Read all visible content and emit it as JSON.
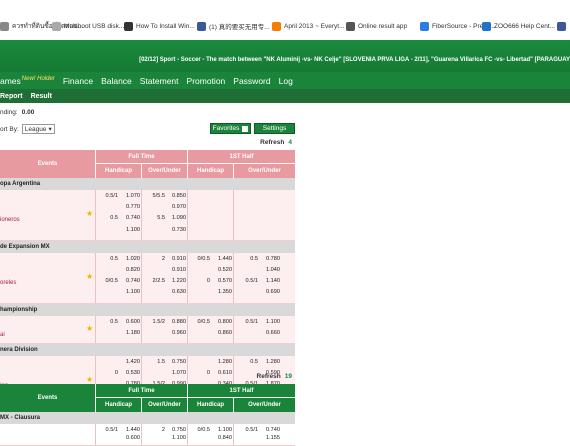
{
  "bookmarks": [
    {
      "label": "ควรทำที่ดินซื้อที่สุดตอน...",
      "icon": "bookmark-icon",
      "color": "#888888"
    },
    {
      "label": "Multiboot USB disk...",
      "icon": "doc-icon",
      "color": "#aaaaaa"
    },
    {
      "label": "How To Install Win...",
      "icon": "g-icon",
      "color": "#333333"
    },
    {
      "label": "(1) 真的要买无用专...",
      "icon": "facebook-icon",
      "color": "#3b5998"
    },
    {
      "label": "April 2013 ~ Everyt...",
      "icon": "blogger-icon",
      "color": "#f57d00"
    },
    {
      "label": "Online result app",
      "icon": "globe-icon",
      "color": "#555555"
    },
    {
      "label": "FiberSource - Precis...",
      "icon": "fiber-icon",
      "color": "#2a7de1"
    },
    {
      "label": "ZOO666 Help Cent...",
      "icon": "zoo-icon",
      "color": "#1e73c8"
    },
    {
      "label": "",
      "icon": "facebook-icon",
      "color": "#3b5998"
    }
  ],
  "ticker": "[02/12] Sport - Soccer - The match between \"NK Aluminij -vs- NK Celje\" [SLOVENIA PRVA LIGA - 2/11], \"Guarena Villarica FC -vs- Libertad\" [PARAGUAY",
  "nav": {
    "games": "ames",
    "new_badge": "New! Holder",
    "finance": "Finance",
    "balance": "Balance",
    "statement": "Statement",
    "promotion": "Promotion",
    "password": "Password",
    "log": "Log"
  },
  "subnav": {
    "report": "Report",
    "result": "Result"
  },
  "pending": {
    "label": "nding:",
    "value": "0.00"
  },
  "sort": {
    "label": "ort By:",
    "value": "League"
  },
  "favorites_label": "Favorites",
  "settings_label": "Settings",
  "table1": {
    "refresh_label": "Refresh",
    "refresh_count": "4",
    "headers": {
      "events": "Events",
      "full_time": "Full Time",
      "first_half": "1ST Half",
      "handicap": "Handicap",
      "over_under": "Over/Under"
    },
    "leagues": [
      {
        "name": "opa Argentina"
      },
      {
        "name": "de Expansion MX"
      },
      {
        "name": "hampionship"
      },
      {
        "name": "nera Division"
      }
    ],
    "matches": [
      {
        "team": "ioneros",
        "rows": [
          [
            "0.5/1",
            "1.070",
            "5/5.5",
            "0.850",
            "",
            "",
            "",
            ""
          ],
          [
            "",
            "0.770",
            "",
            "0.970",
            "",
            "",
            "",
            ""
          ],
          [
            "0.5",
            "0.740",
            "5.5",
            "1.090",
            "",
            "",
            "",
            ""
          ],
          [
            "",
            "1.100",
            "",
            "0.730",
            "",
            "",
            "",
            ""
          ]
        ]
      },
      {
        "team": "oreles",
        "rows": [
          [
            "0.5",
            "1.020",
            "2",
            "0.910",
            "0/0.5",
            "1.440",
            "0.5",
            "0.780"
          ],
          [
            "",
            "0.820",
            "",
            "0.910",
            "",
            "0.520",
            "",
            "1.040"
          ],
          [
            "0/0.5",
            "0.740",
            "2/2.5",
            "1.220",
            "0",
            "0.570",
            "0.5/1",
            "1.140"
          ],
          [
            "",
            "1.100",
            "",
            "0.630",
            "",
            "1.350",
            "",
            "0.690"
          ]
        ]
      },
      {
        "team": "ai",
        "rows": [
          [
            "0.5",
            "0.600",
            "1.5/2",
            "0.880",
            "0/0.5",
            "0.800",
            "0.5/1",
            "1.100"
          ],
          [
            "",
            "1.180",
            "",
            "0.960",
            "",
            "0.860",
            "",
            "0.660"
          ]
        ]
      },
      {
        "team": "ing",
        "rows": [
          [
            "",
            "1.420",
            "1.5",
            "0.750",
            "",
            "1.280",
            "0.5",
            "1.280"
          ],
          [
            "0",
            "0.530",
            "",
            "1.070",
            "0",
            "0.610",
            "",
            "0.590"
          ],
          [
            "",
            "0.780",
            "1.5/2",
            "0.990",
            "",
            "0.340",
            "0.5/1",
            "1.870"
          ],
          [
            "0/0.5",
            "1.060",
            "",
            "0.830",
            "0/0.5",
            "1.240",
            "",
            "0.340"
          ]
        ]
      }
    ]
  },
  "table2": {
    "refresh_label": "Refresh",
    "refresh_count": "19",
    "headers": {
      "events": "Events",
      "full_time": "Full Time",
      "first_half": "1ST Half",
      "handicap": "Handicap",
      "over_under": "Over/Under"
    },
    "league": "MX - Clausura",
    "rows": [
      [
        "0.5/1",
        "1.440",
        "2",
        "0.750",
        "0/0.5",
        "1.100",
        "0.5/1",
        "0.740"
      ],
      [
        "",
        "0.600",
        "",
        "1.100",
        "",
        "0.840",
        "",
        "1.155"
      ]
    ]
  },
  "colors": {
    "brand_green": "#1a853a",
    "header_pink": "#e89aa1",
    "row_pink": "#fdeef0",
    "league_grey": "#d9d9d9"
  }
}
